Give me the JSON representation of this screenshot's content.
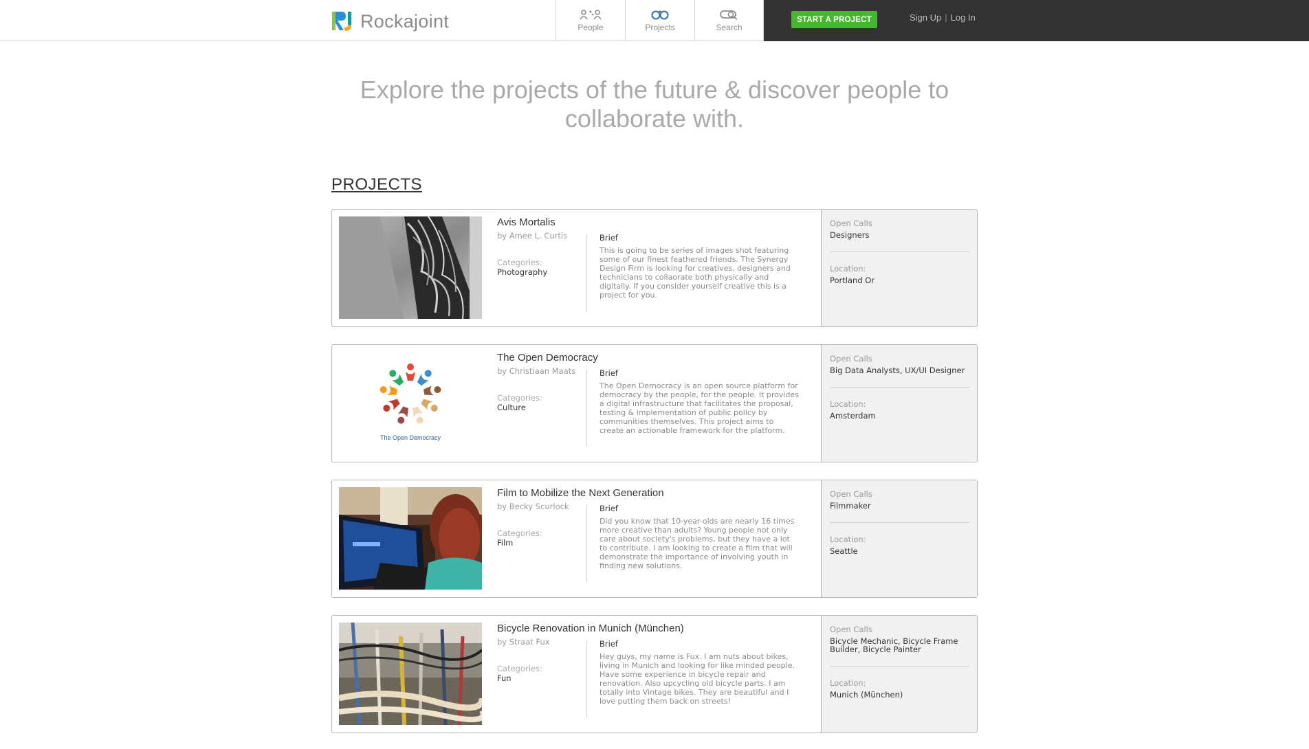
{
  "header": {
    "logo_text": "Rockajoint",
    "nav": [
      {
        "label": "People",
        "icon": "people-icon"
      },
      {
        "label": "Projects",
        "icon": "projects-icon"
      },
      {
        "label": "Search",
        "icon": "search-icon"
      }
    ],
    "start_button": "START A PROJECT",
    "sign_up": "Sign Up",
    "separator": "|",
    "log_in": "Log In"
  },
  "hero": {
    "line1": "Explore the projects of the future & discover people to",
    "line2": "collaborate with."
  },
  "section_title": "PROJECTS",
  "labels": {
    "categories": "Categories:",
    "brief": "Brief",
    "open_calls": "Open Calls",
    "location": "Location:",
    "by": "by"
  },
  "projects": [
    {
      "title": "Avis Mortalis",
      "author": "Amee L. Curtis",
      "category": "Photography",
      "brief": "This is going to be series of images shot featuring some of our finest feathered friends. The Synergy Design Firm is looking for creatives, designers and technicians to collaorate both physically and digitally. If you consider yourself creative this is a project for you.",
      "open_calls": "Designers",
      "location": "Portland Or",
      "image": "feathered-jacket-photo"
    },
    {
      "title": "The Open Democracy",
      "author": "Christiaan Maats",
      "category": "Culture",
      "brief": "The Open Democracy is an open source platform for democracy by the people, for the people. It provides a digital infrastructure that facilitates the proposal, testing & implementation of public policy by communities themselves. This project aims to create an actionable framework for the platform.",
      "open_calls": "Big Data Analysts, UX/UI Designer",
      "location": "Amsterdam",
      "image": "open-democracy-logo",
      "logo_caption": "The Open Democracy"
    },
    {
      "title": "Film to Mobilize the Next Generation",
      "author": "Becky Scurlock",
      "category": "Film",
      "brief": "Did you know that 10-year-olds are nearly 16 times more creative than adults? Young people not only care about society's problems, but they have a lot to contribute. I am looking to create a film that will demonstrate the importance of involving youth in finding new solutions.",
      "open_calls": "Filmmaker",
      "location": "Seattle",
      "image": "girl-with-laptop-photo"
    },
    {
      "title": "Bicycle Renovation in Munich (München)",
      "author": "Straat Fux",
      "category": "Fun",
      "brief": "Hey guys, my name is Fux. I am nuts about bikes, living in Munich and looking for like minded people. Have some experience in bicycle repair and renovation. Also upcycling old bicycle parts. I am totally into Vintage bikes. They are beautiful and I love putting them back on streets!",
      "open_calls": "Bicycle Mechanic, Bicycle Frame Builder, Bicycle Painter",
      "location": "Munich (München)",
      "image": "vintage-bicycles-photo"
    }
  ],
  "colors": {
    "accent_green": "#45b830",
    "topbar_dark": "#333333",
    "side_panel": "#f0f1f0"
  }
}
